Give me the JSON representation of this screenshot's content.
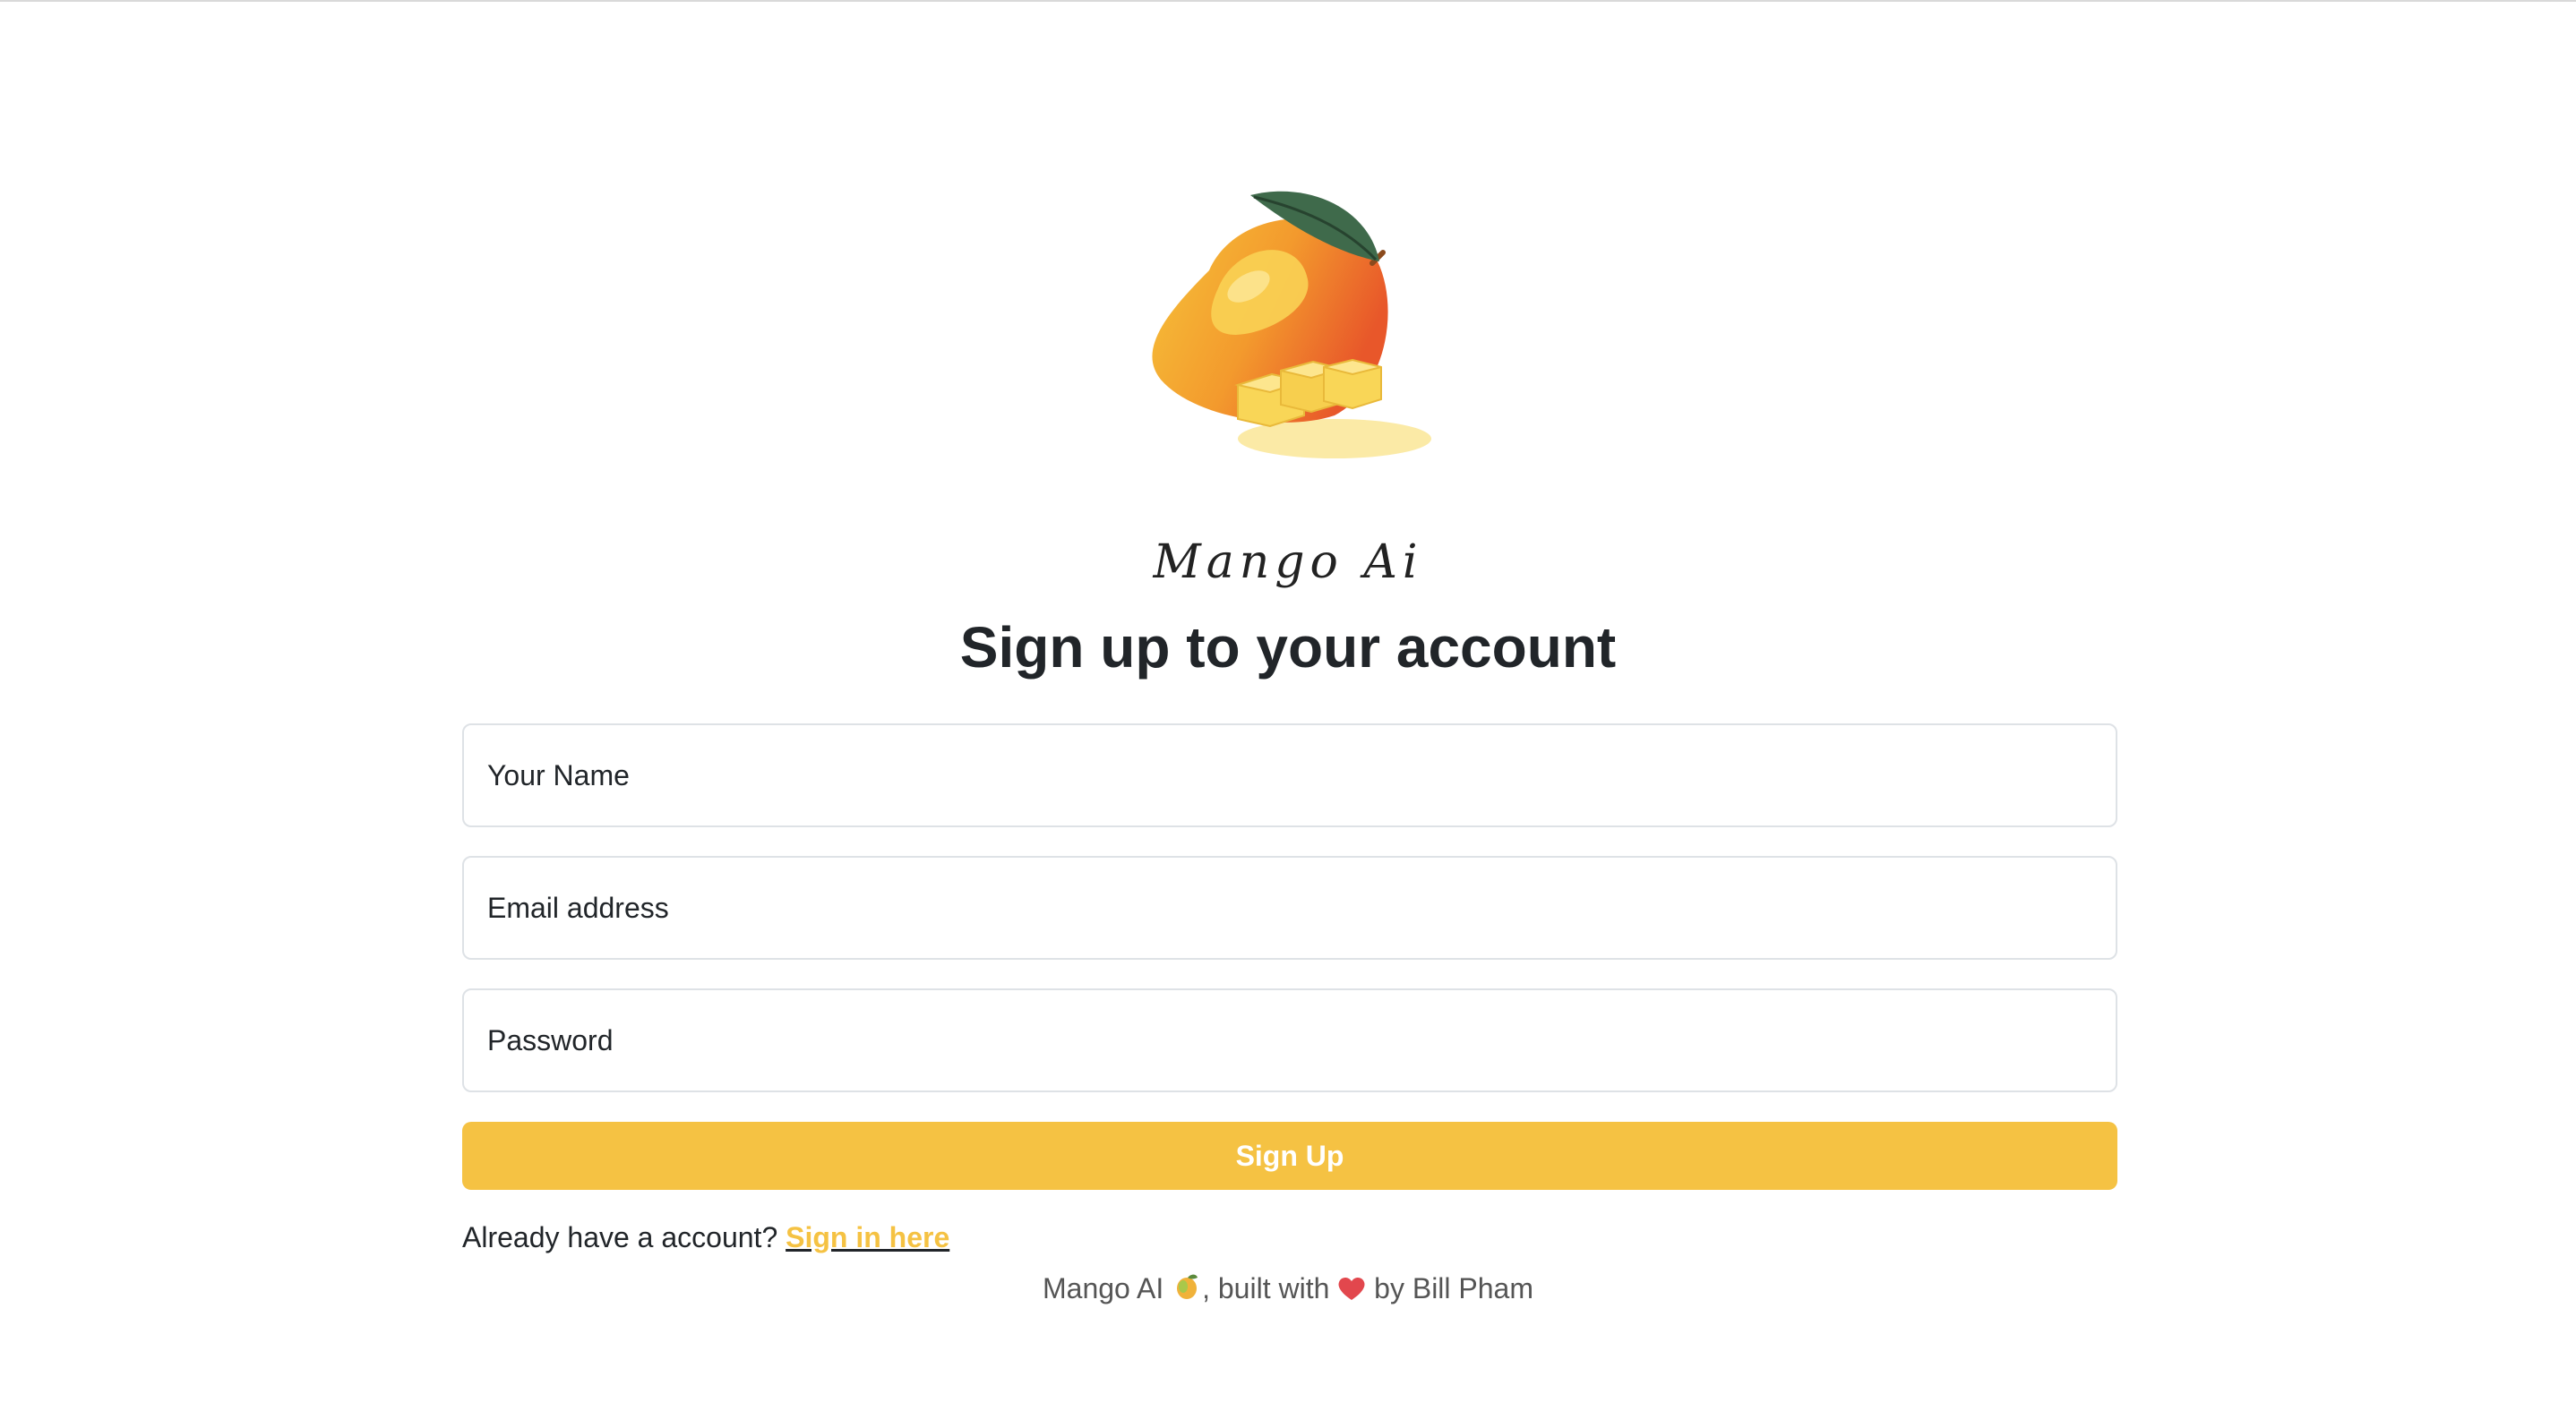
{
  "brand": {
    "name": "Mango Ai"
  },
  "heading": "Sign up to your account",
  "form": {
    "name_placeholder": "Your Name",
    "email_placeholder": "Email address",
    "password_placeholder": "Password",
    "submit_label": "Sign Up"
  },
  "signin": {
    "prompt": "Already have a account?",
    "link_label": "Sign in here"
  },
  "footer": {
    "app_name": "Mango AI",
    "built_with": ", built with",
    "by_author": "by Bill Pham"
  },
  "icons": {
    "logo": "mango-illustration",
    "footer_app": "mango-icon",
    "footer_love": "heart-icon"
  },
  "colors": {
    "accent": "#f5c243",
    "text": "#212529",
    "border": "#dee2e6",
    "footer_text": "#555555"
  }
}
